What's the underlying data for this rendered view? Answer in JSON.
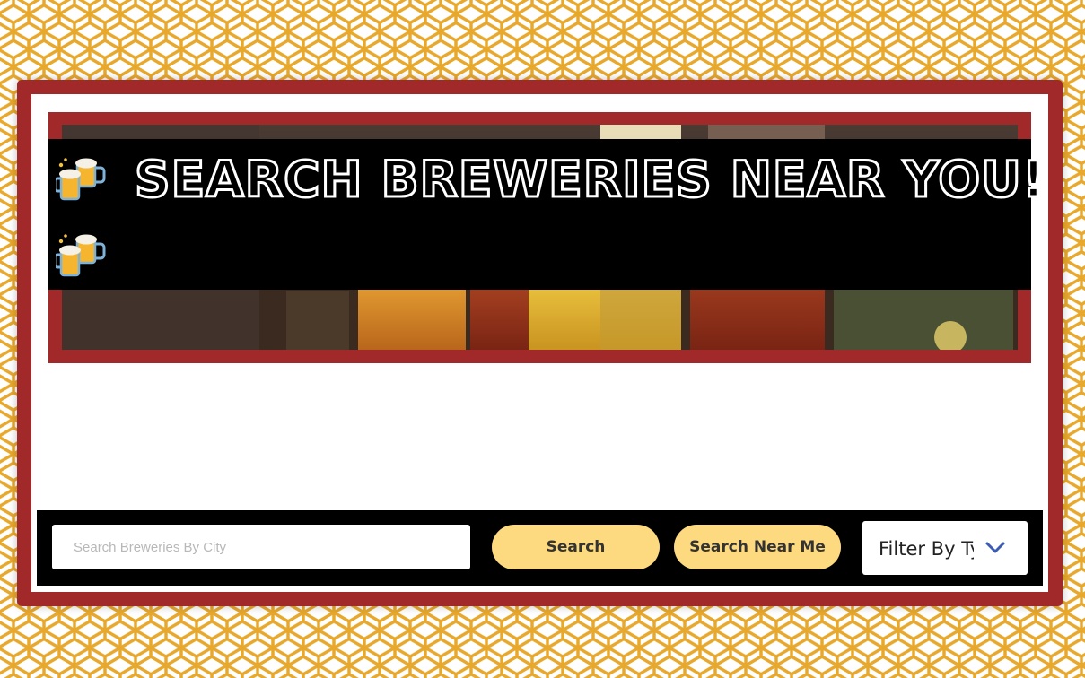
{
  "page": {
    "background_pattern": "honeycomb",
    "pattern_color": "#e8a82c",
    "frame_color": "#a2292a"
  },
  "header": {
    "title": "SEARCH BREWERIES NEAR YOU!",
    "icon": "beer-mugs-icon",
    "icon_count": 2
  },
  "search": {
    "placeholder": "Search Breweries By City",
    "value": "",
    "search_label": "Search",
    "near_me_label": "Search Near Me",
    "button_color": "#fdd97f"
  },
  "filter": {
    "selected": "Filter By Type",
    "icon": "chevron-down-icon"
  }
}
